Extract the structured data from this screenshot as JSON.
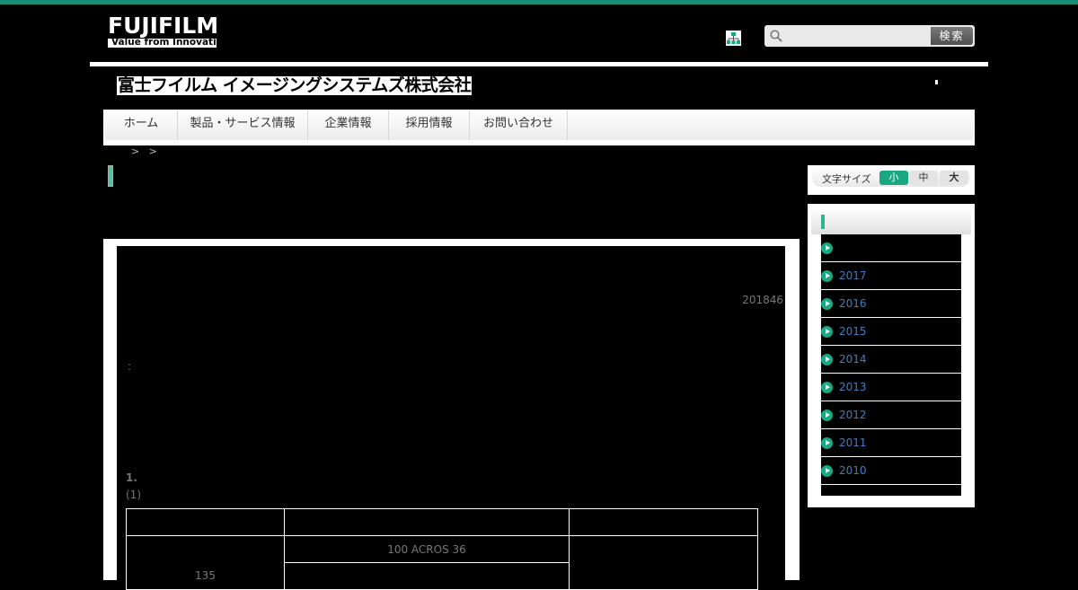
{
  "colors": {
    "accent": "#168c73",
    "button_green": "#1aa783",
    "link_blue": "#3b7fc6"
  },
  "header": {
    "logo_text": "FUJIFILM",
    "logo_tagline": "Value from Innovation",
    "company_name": "富士フイルム イメージングシステムズ株式会社",
    "sitemap_icon": "sitemap-icon",
    "search": {
      "placeholder": "",
      "button_label": "検索"
    }
  },
  "nav": {
    "items": [
      {
        "label": "ホーム"
      },
      {
        "label": "製品・サービス情報"
      },
      {
        "label": "企業情報"
      },
      {
        "label": "採用情報"
      },
      {
        "label": "お問い合わせ"
      }
    ]
  },
  "breadcrumb": {
    "sep1": ">",
    "sep2": ">"
  },
  "font_size": {
    "label": "文字サイズ",
    "options": [
      "小",
      "中",
      "大"
    ],
    "selected": "小"
  },
  "archive": {
    "years": [
      "",
      "2017",
      "2016",
      "2015",
      "2014",
      "2013",
      "2012",
      "2011",
      "2010"
    ]
  },
  "article": {
    "date": "201846",
    "colon": ":",
    "section": "1.",
    "subsection": "(1)",
    "table": {
      "row2_col1": "135",
      "row2_col2": "100 ACROS 36"
    }
  }
}
